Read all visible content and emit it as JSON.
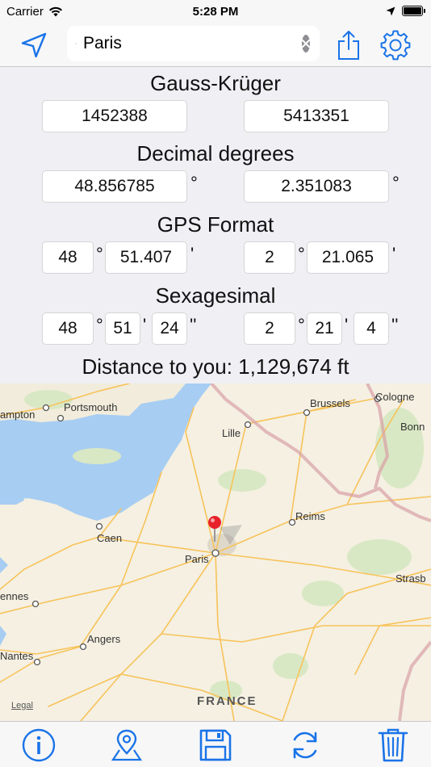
{
  "status": {
    "carrier": "Carrier",
    "time": "5:28 PM"
  },
  "search": {
    "value": "Paris",
    "placeholder": ""
  },
  "sections": {
    "gauss": {
      "title": "Gauss-Krüger",
      "x": "1452388",
      "y": "5413351"
    },
    "decimal": {
      "title": "Decimal degrees",
      "lat": "48.856785",
      "lon": "2.351083",
      "deg": "°"
    },
    "gps": {
      "title": "GPS Format",
      "lat_deg": "48",
      "lat_min": "51.407",
      "lon_deg": "2",
      "lon_min": "21.065",
      "deg": "°",
      "min": "'"
    },
    "sexagesimal": {
      "title": "Sexagesimal",
      "lat_deg": "48",
      "lat_min": "51",
      "lat_sec": "24",
      "lon_deg": "2",
      "lon_min": "21",
      "lon_sec": "4",
      "deg": "°",
      "min": "'",
      "sec": "''"
    }
  },
  "distance": "Distance to you: 1,129,674 ft",
  "map": {
    "labels": {
      "hampton": "ampton",
      "portsmouth": "Portsmouth",
      "brussels": "Brussels",
      "cologne": "Cologne",
      "bonn": "Bonn",
      "lille": "Lille",
      "reims": "Reims",
      "caen": "Caen",
      "paris": "Paris",
      "strasb": "Strasb",
      "rennes": "ennes",
      "angers": "Angers",
      "nantes": "Nantes",
      "france": "FRANCE",
      "legal": "Legal"
    }
  },
  "colors": {
    "accent": "#1a73e8",
    "water": "#a7cdf2",
    "land": "#f5f0e2",
    "road": "#f7c35a",
    "border": "#d9a0a6",
    "pin": "#e8222b"
  }
}
